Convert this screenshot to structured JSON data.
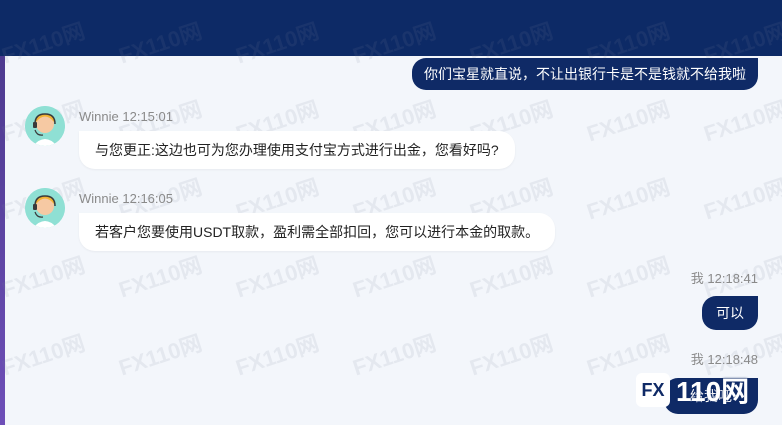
{
  "messages": [
    {
      "type": "outgoing",
      "text": "你们宝星就直说，不让出银行卡是不是钱就不给我啦"
    },
    {
      "type": "incoming",
      "sender": "Winnie",
      "time": "12:15:01",
      "text": "与您更正:这边也可为您办理使用支付宝方式进行出金，您看好吗?"
    },
    {
      "type": "incoming",
      "sender": "Winnie",
      "time": "12:16:05",
      "text": "若客户您要使用USDT取款，盈利需全部扣回，您可以进行本金的取款。"
    },
    {
      "type": "outgoing",
      "sender": "我",
      "time": "12:18:41",
      "text": "可以"
    },
    {
      "type": "outgoing",
      "sender": "我",
      "time": "12:18:48",
      "text": "给我吧"
    }
  ],
  "watermark": {
    "text": "110网",
    "badge": "FX",
    "brand": "110网"
  },
  "colors": {
    "header": "#0d2a66",
    "outgoing_bubble": "#0f2a66",
    "incoming_bubble": "#ffffff",
    "background": "#f3f6fb"
  },
  "icons": {
    "avatar": "support-agent-avatar"
  }
}
